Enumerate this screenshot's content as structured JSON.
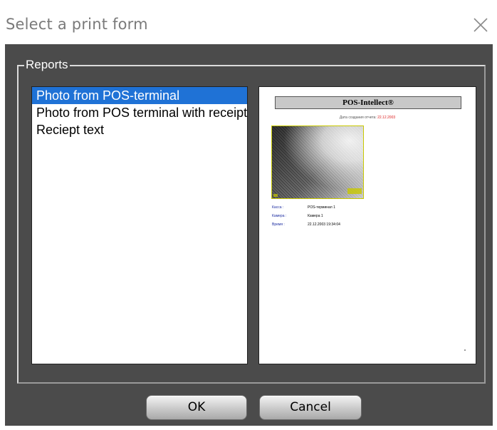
{
  "window": {
    "title": "Select a print form"
  },
  "group": {
    "label": "Reports"
  },
  "reports": {
    "items": [
      {
        "label": "Photo from POS-terminal",
        "selected": true
      },
      {
        "label": "Photo from POS terminal with receipt",
        "selected": false
      },
      {
        "label": "Reciept text",
        "selected": false
      }
    ]
  },
  "preview": {
    "header": "POS-Intellect®",
    "date_label": "Дата создания отчета:",
    "date_value": "22.12.2003",
    "rows": [
      {
        "key": "Касса :",
        "value": "POS-терминал 1"
      },
      {
        "key": "Камера :",
        "value": "Камера 1"
      },
      {
        "key": "Время :",
        "value": "22.12.2003 19:34:04"
      }
    ]
  },
  "buttons": {
    "ok": "OK",
    "cancel": "Cancel"
  },
  "colors": {
    "dialog_bg": "#4b4b4b",
    "selection": "#1f72d6"
  }
}
